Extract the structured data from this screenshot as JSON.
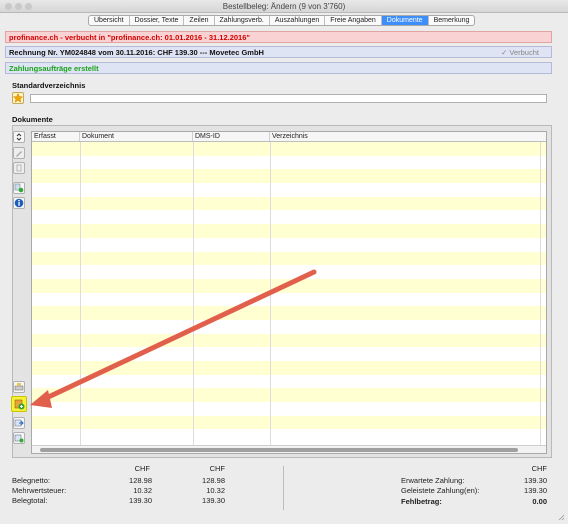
{
  "window": {
    "title": "Bestellbeleg: Ändern (9 von 3'760)"
  },
  "tabs": [
    {
      "label": "Übersicht",
      "active": false
    },
    {
      "label": "Dossier, Texte",
      "active": false
    },
    {
      "label": "Zeilen",
      "active": false
    },
    {
      "label": "Zahlungsverb.",
      "active": false
    },
    {
      "label": "Auszahlungen",
      "active": false
    },
    {
      "label": "Freie Angaben",
      "active": false
    },
    {
      "label": "Dokumente",
      "active": true
    },
    {
      "label": "Bemerkung",
      "active": false
    }
  ],
  "banners": {
    "booked": "profinance.ch - verbucht in \"profinance.ch: 01.01.2016 - 31.12.2016\"",
    "invoice": "Rechnung Nr. YM024848 vom 30.11.2016: CHF 139.30 --- Movetec GmbH",
    "status": "✓ Verbucht",
    "payments": "Zahlungsaufträge erstellt"
  },
  "standard_dir": {
    "title": "Standardverzeichnis",
    "value": ""
  },
  "documents": {
    "title": "Dokumente",
    "columns": [
      "Erfasst",
      "Dokument",
      "DMS-ID",
      "Verzeichnis"
    ],
    "rows": []
  },
  "totals": {
    "currency_header_1": "CHF",
    "currency_header_2": "CHF",
    "netto_label": "Belegnetto:",
    "netto_1": "128.98",
    "netto_2": "128.98",
    "vat_label": "Mehrwertsteuer:",
    "vat_1": "10.32",
    "vat_2": "10.32",
    "total_label": "Belegtotal:",
    "total_1": "139.30",
    "total_2": "139.30"
  },
  "payments": {
    "currency_header": "CHF",
    "expected_label": "Erwartete Zahlung:",
    "expected": "139.30",
    "paid_label": "Geleistete Zahlung(en):",
    "paid": "139.30",
    "missing_label": "Fehlbetrag:",
    "missing": "0.00"
  },
  "colors": {
    "accent": "#3d8ef8",
    "error_text": "#d40000",
    "success_text": "#1aa41a",
    "row_highlight": "#ffffd1",
    "arrow": "#e0604c",
    "icon_highlight": "#f6f23a"
  },
  "icons": [
    "star-icon",
    "sort-icon",
    "edit-icon",
    "copy-icon",
    "link-icon",
    "info-icon",
    "scan-icon",
    "add-document-icon",
    "import-icon",
    "export-icon"
  ]
}
